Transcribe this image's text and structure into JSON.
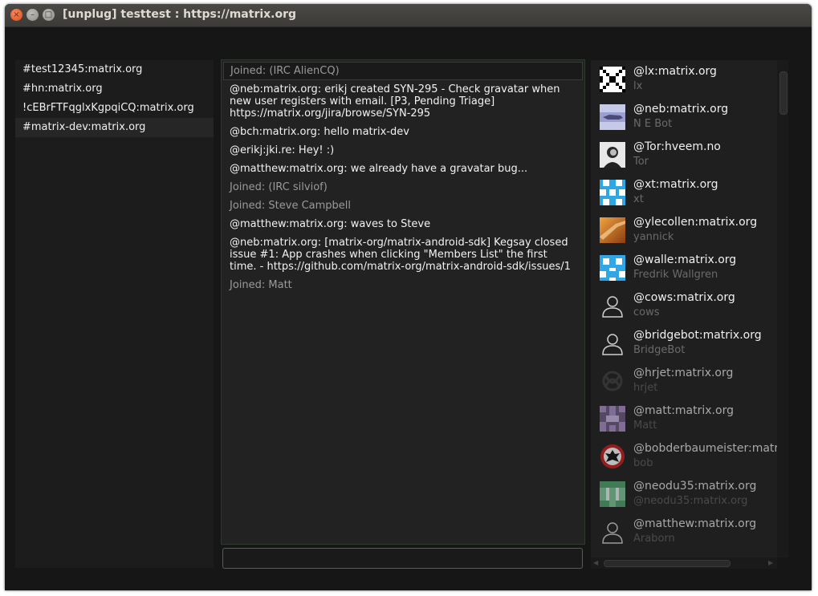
{
  "window": {
    "title": "[unplug] testtest : https://matrix.org",
    "accent": "#df4a16"
  },
  "rooms": [
    {
      "label": "#test12345:matrix.org",
      "selected": false
    },
    {
      "label": "#hn:matrix.org",
      "selected": false
    },
    {
      "label": "!cEBrFTFqglxKgpqiCQ:matrix.org",
      "selected": false
    },
    {
      "label": "#matrix-dev:matrix.org",
      "selected": true
    }
  ],
  "messages": [
    {
      "text": "Joined: (IRC AlienCQ)",
      "kind": "join"
    },
    {
      "text": "@neb:matrix.org: erikj created SYN-295 - Check gravatar when new user registers with email. [P3, Pending Triage] https://matrix.org/jira/browse/SYN-295",
      "kind": "msg"
    },
    {
      "text": "@bch:matrix.org: hello matrix-dev",
      "kind": "msg"
    },
    {
      "text": "@erikj:jki.re: Hey! :)",
      "kind": "msg"
    },
    {
      "text": "@matthew:matrix.org: we already have a gravatar bug...",
      "kind": "msg"
    },
    {
      "text": "Joined: (IRC silviof)",
      "kind": "join"
    },
    {
      "text": "Joined: Steve Campbell",
      "kind": "join"
    },
    {
      "text": "@matthew:matrix.org: waves to Steve",
      "kind": "msg"
    },
    {
      "text": "@neb:matrix.org: [matrix-org/matrix-android-sdk] Kegsay closed issue #1: App crashes when clicking \"Members List\" the first time. - https://github.com/matrix-org/matrix-android-sdk/issues/1",
      "kind": "msg"
    },
    {
      "text": "Joined: Matt",
      "kind": "join"
    }
  ],
  "composer": {
    "value": ""
  },
  "members": [
    {
      "id": "@lx:matrix.org",
      "name": "lx",
      "avatar": "qr-avatar-icon"
    },
    {
      "id": "@neb:matrix.org",
      "name": "N E Bot",
      "avatar": "bot-avatar-icon"
    },
    {
      "id": "@Tor:hveem.no",
      "name": "Tor",
      "avatar": "photo-avatar-icon"
    },
    {
      "id": "@xt:matrix.org",
      "name": "xt",
      "avatar": "identicon-blue-icon"
    },
    {
      "id": "@ylecollen:matrix.org",
      "name": "yannick",
      "avatar": "orange-photo-avatar-icon"
    },
    {
      "id": "@walle:matrix.org",
      "name": "Fredrik Wallgren",
      "avatar": "identicon-blue-icon"
    },
    {
      "id": "@cows:matrix.org",
      "name": "cows",
      "avatar": "default-user-icon"
    },
    {
      "id": "@bridgebot:matrix.org",
      "name": "BridgeBot",
      "avatar": "default-user-icon"
    },
    {
      "id": "@hrjet:matrix.org",
      "name": "hrjet",
      "avatar": "knot-avatar-icon",
      "offline": true
    },
    {
      "id": "@matt:matrix.org",
      "name": "Matt",
      "avatar": "identicon-purple-icon",
      "offline": true
    },
    {
      "id": "@bobderbaumeister:matrix.org",
      "name": "bob",
      "avatar": "eagle-crest-icon",
      "offline": true
    },
    {
      "id": "@neodu35:matrix.org",
      "name": "@neodu35:matrix.org",
      "avatar": "identicon-green-icon",
      "offline": true
    },
    {
      "id": "@matthew:matrix.org",
      "name": "Araborn",
      "avatar": "default-user-icon",
      "offline": true
    }
  ]
}
